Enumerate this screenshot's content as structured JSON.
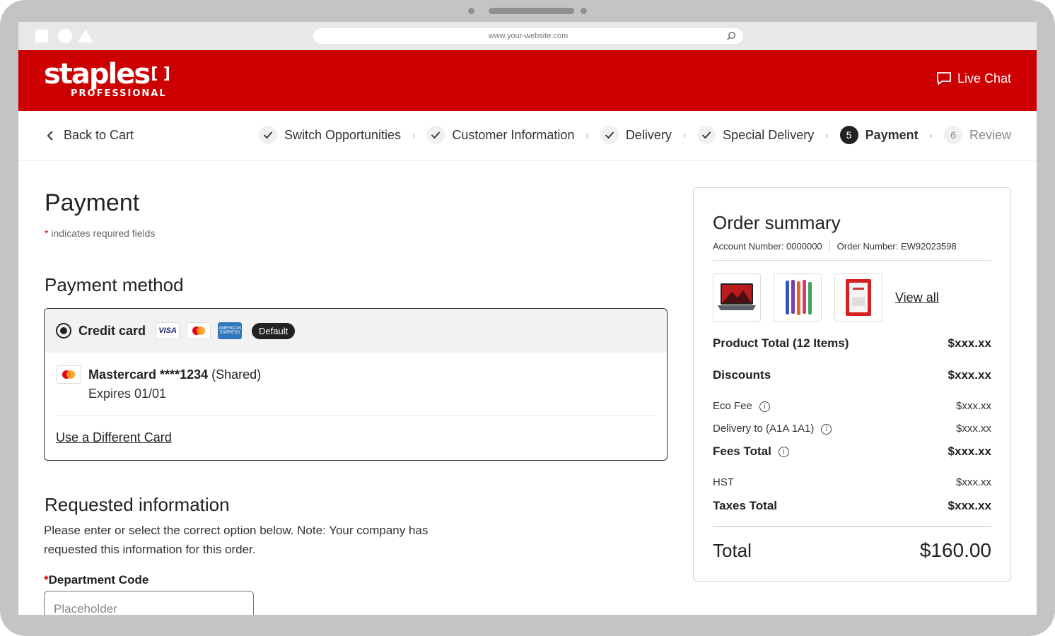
{
  "browser": {
    "url": "www.your-website.com"
  },
  "header": {
    "brand": "staples",
    "brand_sub": "PROFESSIONAL",
    "live_chat": "Live Chat",
    "color": "#cc0000"
  },
  "nav": {
    "back_label": "Back to Cart",
    "steps": [
      {
        "label": "Switch Opportunities",
        "state": "done"
      },
      {
        "label": "Customer Information",
        "state": "done"
      },
      {
        "label": "Delivery",
        "state": "done"
      },
      {
        "label": "Special Delivery",
        "state": "done"
      },
      {
        "num": "5",
        "label": "Payment",
        "state": "active"
      },
      {
        "num": "6",
        "label": "Review",
        "state": "upcoming"
      }
    ]
  },
  "page": {
    "title": "Payment",
    "required_star": "*",
    "required_note": "indicates required fields"
  },
  "payment_method": {
    "heading": "Payment method",
    "option_label": "Credit card",
    "cards": [
      "VISA",
      "mastercard",
      "AMERICAN EXPRESS"
    ],
    "default_badge": "Default",
    "saved_card": {
      "name": "Mastercard ****1234",
      "tag": "(Shared)",
      "expires": "Expires 01/01"
    },
    "different_card": "Use a Different Card"
  },
  "requested_info": {
    "heading": "Requested information",
    "text": "Please enter or select the correct option below.  Note: Your company has requested this information for this order.",
    "field_star": "*",
    "field_label": "Department Code",
    "field_placeholder": "Placeholder"
  },
  "summary": {
    "title": "Order summary",
    "account": "Account Number: 0000000",
    "order": "Order Number: EW92023598",
    "view_all": "View all",
    "rows": {
      "product_total": {
        "label": "Product Total (12 Items)",
        "value": "$xxx.xx"
      },
      "discounts": {
        "label": "Discounts",
        "value": "$xxx.xx"
      },
      "eco_fee": {
        "label": "Eco Fee",
        "value": "$xxx.xx"
      },
      "delivery": {
        "label": "Delivery to (A1A 1A1)",
        "value": "$xxx.xx"
      },
      "fees_total": {
        "label": "Fees Total",
        "value": "$xxx.xx"
      },
      "hst": {
        "label": "HST",
        "value": "$xxx.xx"
      },
      "taxes_total": {
        "label": "Taxes Total",
        "value": "$xxx.xx"
      }
    },
    "total_label": "Total",
    "total_value": "$160.00"
  }
}
